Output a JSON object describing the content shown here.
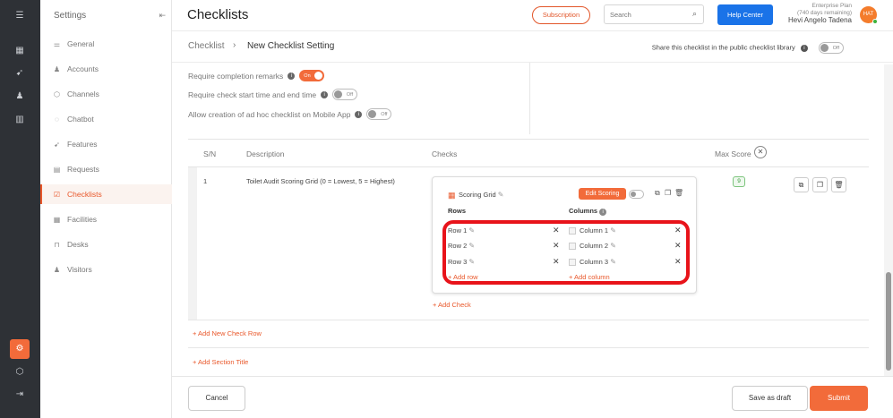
{
  "rail": {
    "icons": [
      "menu-icon",
      "dashboard-icon",
      "rocket-icon",
      "people-icon",
      "analytics-icon",
      "settings-icon",
      "cube-icon",
      "logout-icon"
    ]
  },
  "sidebar": {
    "title": "Settings",
    "items": [
      {
        "label": "General",
        "icon": "sliders-icon"
      },
      {
        "label": "Accounts",
        "icon": "users-icon"
      },
      {
        "label": "Channels",
        "icon": "cube-icon"
      },
      {
        "label": "Chatbot",
        "icon": "chat-icon"
      },
      {
        "label": "Features",
        "icon": "rocket-icon"
      },
      {
        "label": "Requests",
        "icon": "list-icon"
      },
      {
        "label": "Checklists",
        "icon": "checklist-icon"
      },
      {
        "label": "Facilities",
        "icon": "calendar-icon"
      },
      {
        "label": "Desks",
        "icon": "desk-icon"
      },
      {
        "label": "Visitors",
        "icon": "visitors-icon"
      }
    ]
  },
  "header": {
    "title": "Checklists",
    "subscription_label": "Subscription",
    "search_placeholder": "Search",
    "help_label": "Help Center",
    "plan_line1": "Enterprise Plan",
    "plan_line2": "(740 days remaining)",
    "user_name": "Hevi Angelo Tadena",
    "avatar_initials": "HAT"
  },
  "breadcrumb": {
    "parent": "Checklist",
    "current": "New Checklist Setting",
    "share_label": "Share this checklist in the public checklist library",
    "share_toggle": "Off"
  },
  "options": [
    {
      "label": "Require completion remarks",
      "toggle": "On"
    },
    {
      "label": "Require check start time and end time",
      "toggle": "Off"
    },
    {
      "label": "Allow creation of ad hoc checklist on Mobile App",
      "toggle": "Off"
    }
  ],
  "table": {
    "headers": {
      "sn": "S/N",
      "description": "Description",
      "checks": "Checks",
      "max_score": "Max Score"
    },
    "row": {
      "sn": "1",
      "description": "Toilet Audit Scoring Grid (0 = Lowest, 5 = Highest)",
      "max_score": "9"
    }
  },
  "scoring": {
    "title": "Scoring Grid",
    "edit_label": "Edit Scoring",
    "rows_header": "Rows",
    "columns_header": "Columns",
    "rows": [
      "Row 1",
      "Row 2",
      "Row 3"
    ],
    "columns": [
      "Column 1",
      "Column 2",
      "Column 3"
    ],
    "add_row": "+ Add row",
    "add_column": "+ Add column"
  },
  "links": {
    "add_check": "+ Add Check",
    "add_row": "+ Add New Check Row",
    "add_section": "+ Add Section Title"
  },
  "footer": {
    "cancel": "Cancel",
    "save_draft": "Save as draft",
    "submit": "Submit"
  },
  "colors": {
    "accent": "#f26b3a",
    "primary": "#1a73e8",
    "highlight": "#e8131a"
  }
}
